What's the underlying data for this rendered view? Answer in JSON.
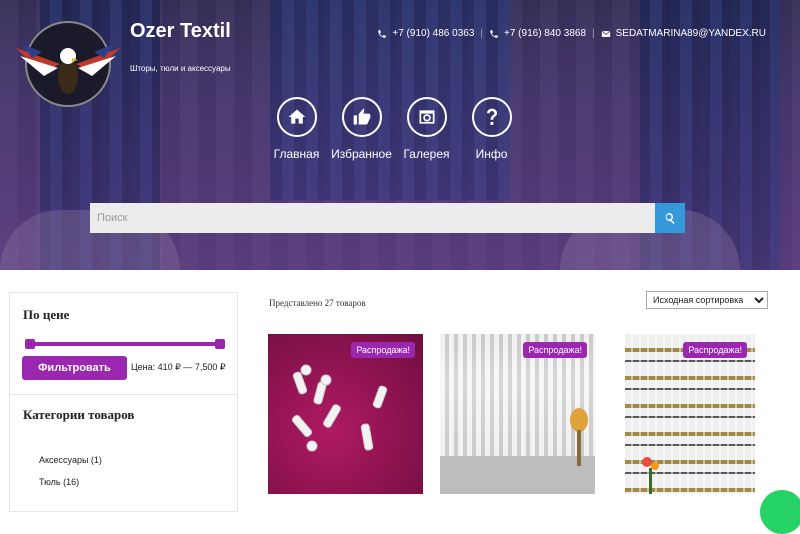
{
  "site": {
    "brand": "Ozer Textil",
    "tagline": "Шторы, тюли и аксессуары"
  },
  "contacts": {
    "phone1": "+7 (910) 486 0363",
    "phone2": "+7 (916) 840 3868",
    "email": "SEDATMARINA89@YANDEX.RU"
  },
  "nav": [
    {
      "label": "Главная",
      "icon": "home-icon"
    },
    {
      "label": "Избранное",
      "icon": "thumbs-up-icon"
    },
    {
      "label": "Галерея",
      "icon": "gallery-icon"
    },
    {
      "label": "Инфо",
      "icon": "question-icon"
    }
  ],
  "search": {
    "placeholder": "Поиск"
  },
  "sidebar": {
    "price_title": "По цене",
    "filter_label": "Фильтровать",
    "price_text": "Цена: 410 ₽ — 7,500 ₽",
    "categories_title": "Категории товаров",
    "categories": [
      {
        "label": "Аксессуары (1)"
      },
      {
        "label": "Тюль (16)"
      }
    ]
  },
  "shop": {
    "results_text": "Представлено 27 товаров",
    "sort_selected": "Исходная сортировка",
    "sale_badge": "Распродажа!"
  },
  "colors": {
    "accent": "#9b27b0",
    "search_button": "#3498db"
  }
}
